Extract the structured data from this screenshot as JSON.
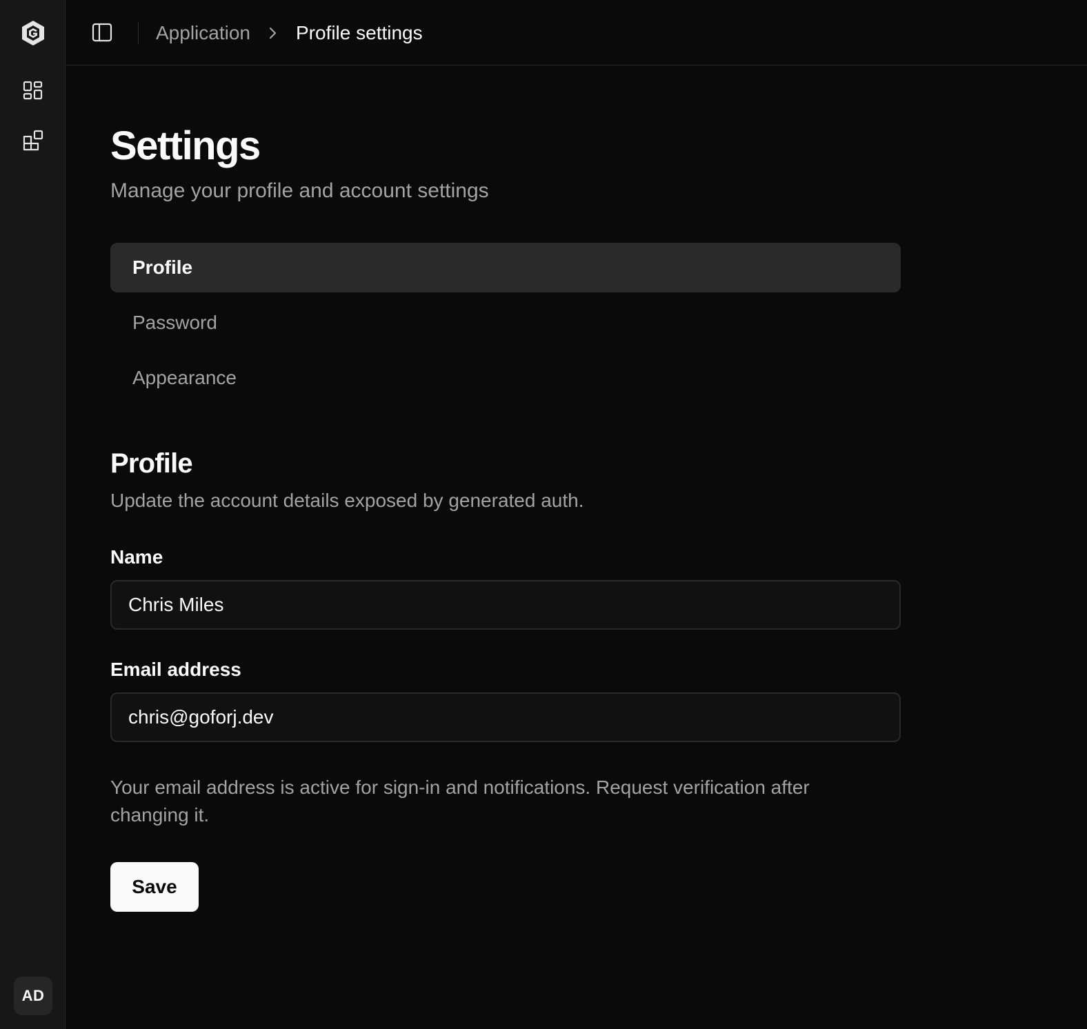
{
  "rail": {
    "avatar_initials": "AD"
  },
  "header": {
    "breadcrumb_parent": "Application",
    "breadcrumb_current": "Profile settings"
  },
  "page": {
    "title": "Settings",
    "subtitle": "Manage your profile and account settings"
  },
  "settings_nav": {
    "items": [
      {
        "label": "Profile",
        "active": true
      },
      {
        "label": "Password",
        "active": false
      },
      {
        "label": "Appearance",
        "active": false
      }
    ]
  },
  "profile_section": {
    "title": "Profile",
    "description": "Update the account details exposed by generated auth.",
    "name_label": "Name",
    "name_value": "Chris Miles",
    "email_label": "Email address",
    "email_value": "chris@goforj.dev",
    "helper_text": "Your email address is active for sign-in and notifications. Request verification after changing it.",
    "save_label": "Save"
  },
  "colors": {
    "background": "#0a0a0a",
    "rail": "#171717",
    "active_tab": "#2a2a2a",
    "muted_text": "#a3a3a3",
    "primary_button": "#fafafa"
  }
}
